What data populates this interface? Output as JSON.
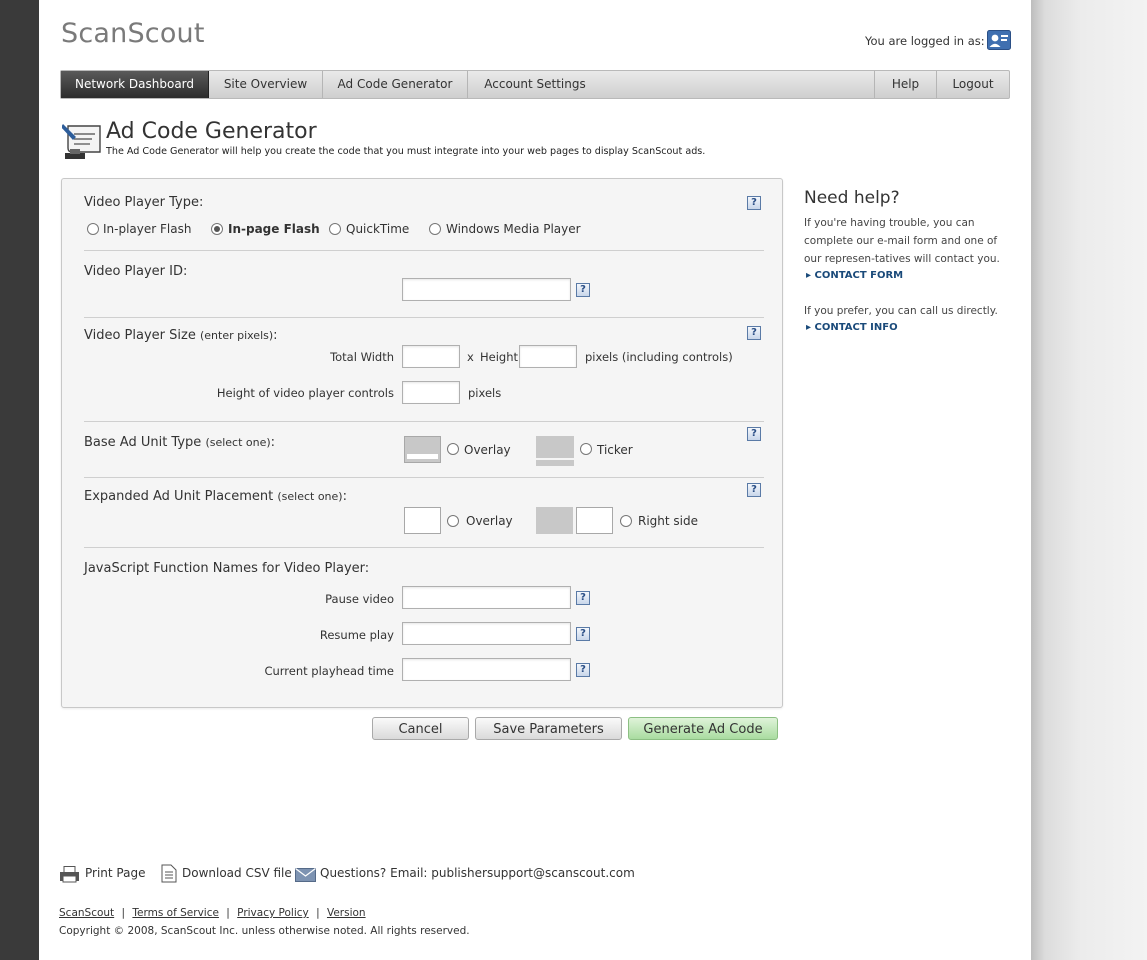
{
  "header": {
    "logo": "ScanScout",
    "login_text": "You are logged in as:"
  },
  "nav": {
    "items": [
      "Network Dashboard",
      "Site Overview",
      "Ad Code Generator",
      "Account Settings"
    ],
    "right_items": [
      "Help",
      "Logout"
    ]
  },
  "page": {
    "title": "Ad Code Generator",
    "subtitle": "The Ad Code Generator will help you create the code that you must integrate into your web pages to display ScanScout ads."
  },
  "form": {
    "player_type": {
      "label": "Video Player  Type:",
      "options": [
        "In-player Flash",
        "In-page Flash",
        "QuickTime",
        "Windows Media Player"
      ],
      "selected": "In-page Flash"
    },
    "player_id": {
      "label": "Video Player ID:",
      "value": ""
    },
    "player_size": {
      "label": "Video Player Size",
      "label_note": "(enter pixels)",
      "label_colon": ":",
      "total_width_label": "Total Width",
      "x_label": "x",
      "height_label": "Height",
      "pixels_including": "pixels (including controls)",
      "controls_label": "Height of video player controls",
      "pixels": "pixels",
      "width_value": "",
      "height_value": "",
      "controls_value": ""
    },
    "base_ad": {
      "label": "Base Ad Unit Type",
      "label_note": "(select one)",
      "label_colon": ":",
      "options": [
        "Overlay",
        "Ticker"
      ]
    },
    "expanded_ad": {
      "label": "Expanded Ad Unit Placement",
      "label_note": "(select one)",
      "label_colon": ":",
      "options": [
        "Overlay",
        "Right side"
      ]
    },
    "js_functions": {
      "label": "JavaScript Function Names for Video Player:",
      "fields": [
        {
          "label": "Pause video",
          "value": ""
        },
        {
          "label": "Resume play",
          "value": ""
        },
        {
          "label": "Current playhead time",
          "value": ""
        }
      ]
    },
    "help_glyph": "?"
  },
  "buttons": {
    "cancel": "Cancel",
    "save": "Save Parameters",
    "generate": "Generate Ad Code"
  },
  "sidebar": {
    "title": "Need help?",
    "text1": "If you're having trouble, you can complete our e-mail form and one of our represen-tatives will contact you.",
    "link1": "CONTACT FORM",
    "text2": "If you prefer, you can call us directly.",
    "link2": "CONTACT INFO"
  },
  "footer": {
    "print": "Print Page",
    "download": "Download CSV file",
    "email": "Questions? Email: publishersupport@scanscout.com",
    "links": [
      "ScanScout",
      "Terms of Service",
      "Privacy Policy",
      "Version"
    ],
    "separator": "|",
    "copyright": "Copyright © 2008, ScanScout Inc. unless otherwise noted. All rights reserved."
  },
  "icons": {
    "user": "user-badge-icon",
    "title": "ad-code-generator-icon",
    "help": "help-question-icon",
    "print": "printer-icon",
    "download": "csv-document-icon",
    "email": "envelope-icon",
    "link_arrow": "triangle-right-icon"
  },
  "colors": {
    "nav_active": "#3a3a3a",
    "accent_link": "#1a4a7a",
    "generate_button": "#b7e2ad",
    "left_band": "#3a3a3a"
  }
}
